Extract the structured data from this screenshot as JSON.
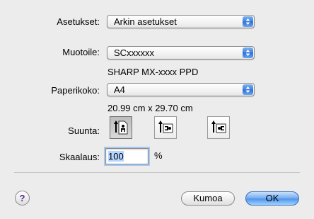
{
  "settings": {
    "label": "Asetukset:",
    "value": "Arkin asetukset"
  },
  "format_for": {
    "label": "Muotoile:",
    "value": "SCxxxxxx",
    "printer_desc": "SHARP MX-xxxx PPD"
  },
  "paper_size": {
    "label": "Paperikoko:",
    "value": "A4",
    "dimensions": "20.99 cm x 29.70 cm"
  },
  "orientation": {
    "label": "Suunta:",
    "options": [
      {
        "name": "portrait",
        "icon": "portrait-orientation-icon",
        "selected": true
      },
      {
        "name": "landscape",
        "icon": "landscape-orientation-icon",
        "selected": false
      },
      {
        "name": "landscape-reversed",
        "icon": "landscape-reversed-orientation-icon",
        "selected": false
      }
    ]
  },
  "scale": {
    "label": "Skaalaus:",
    "value": "100",
    "unit": "%"
  },
  "buttons": {
    "help": "?",
    "cancel": "Kumoa",
    "ok": "OK"
  }
}
